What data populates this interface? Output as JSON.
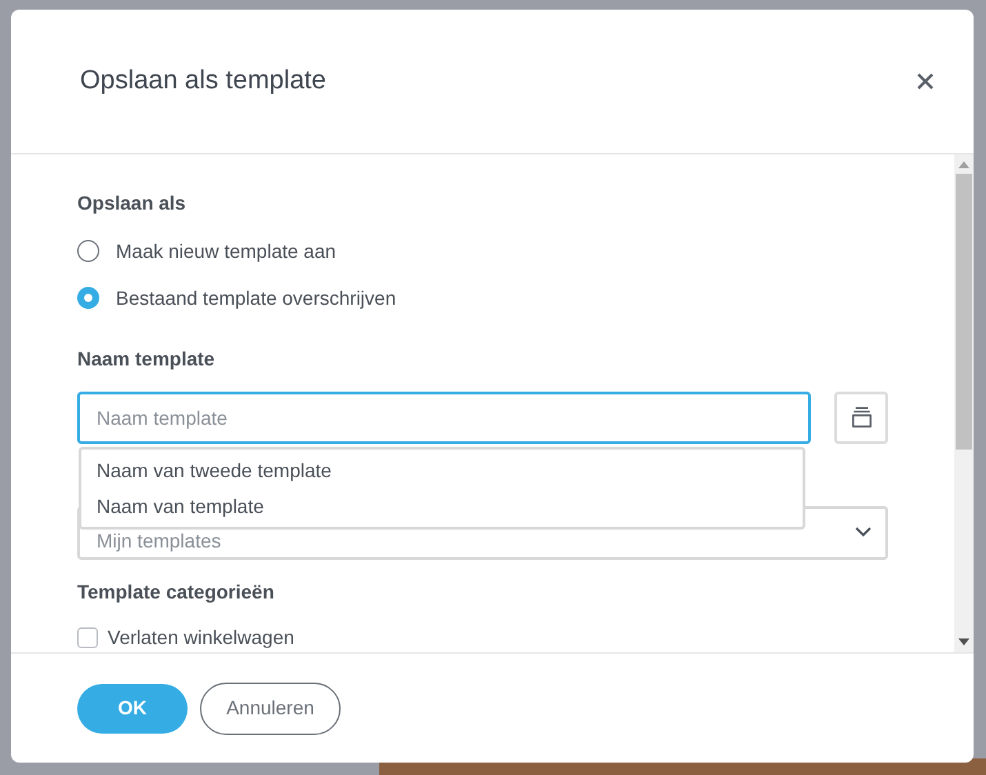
{
  "dialog": {
    "title": "Opslaan als template"
  },
  "save_as": {
    "label": "Opslaan als",
    "options": [
      {
        "label": "Maak nieuw template aan",
        "selected": false
      },
      {
        "label": "Bestaand template overschrijven",
        "selected": true
      }
    ]
  },
  "name_field": {
    "label": "Naam template",
    "placeholder": "Naam template",
    "suggestions": [
      {
        "label": "Naam van tweede template"
      },
      {
        "label": "Naam van template"
      }
    ]
  },
  "folder_select": {
    "value": "Mijn templates"
  },
  "categories": {
    "label": "Template categorieën",
    "items": [
      {
        "label": "Verlaten winkelwagen",
        "checked": false
      }
    ]
  },
  "buttons": [
    {
      "kind": "primary",
      "label": "OK"
    },
    {
      "kind": "secondary",
      "label": "Annuleren"
    }
  ]
}
